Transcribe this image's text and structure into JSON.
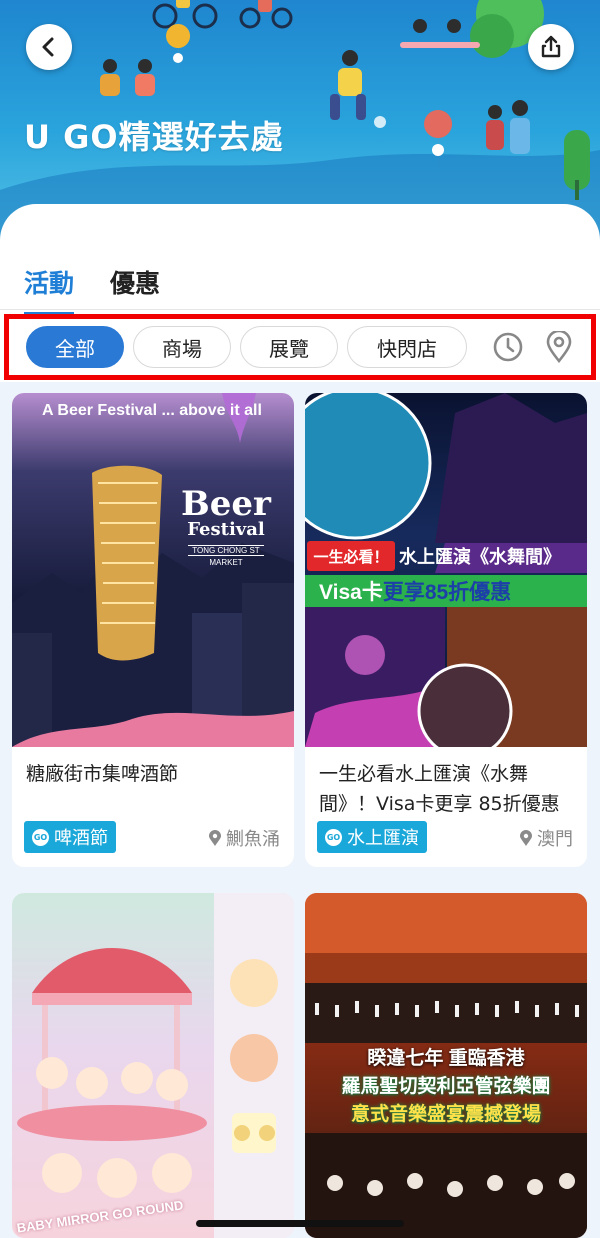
{
  "header": {
    "title": "U GO精選好去處"
  },
  "tabs": [
    {
      "label": "活動",
      "active": true
    },
    {
      "label": "優惠",
      "active": false
    }
  ],
  "filters": {
    "chips": [
      {
        "label": "全部",
        "active": true
      },
      {
        "label": "商場",
        "active": false
      },
      {
        "label": "展覽",
        "active": false
      },
      {
        "label": "快閃店",
        "active": false
      }
    ],
    "icons": [
      "clock-icon",
      "location-pin-icon"
    ]
  },
  "cards": [
    {
      "title": "糖廠街市集啤酒節",
      "tag": "啤酒節",
      "location": "鰂魚涌",
      "image_text": {
        "headline": "A Beer Festival ... above it all",
        "logo_line1": "Beer",
        "logo_line2": "Festival",
        "logo_sub": "TONG CHONG ST",
        "logo_sub2": "MARKET"
      }
    },
    {
      "title": "一生必看水上匯演《水舞間》！Visa卡更享 85折優惠",
      "tag": "水上匯演",
      "location": "澳門",
      "image_text": {
        "badge": "一生必看！",
        "headline": "水上匯演《水舞間》",
        "promo_prefix": "Visa卡",
        "promo_suffix": "更享85折優惠"
      }
    },
    {
      "title": "",
      "image_text": {
        "caption": "BABY MIRROR GO ROUND"
      }
    },
    {
      "title": "",
      "image_text": {
        "line1": "睽違七年 重臨香港",
        "line2": "羅馬聖切契利亞管弦樂團",
        "line3": "意式音樂盛宴震撼登場"
      }
    }
  ],
  "colors": {
    "accent": "#2a79d5",
    "tag": "#1aa7d9",
    "highlight_border": "#f00000"
  }
}
